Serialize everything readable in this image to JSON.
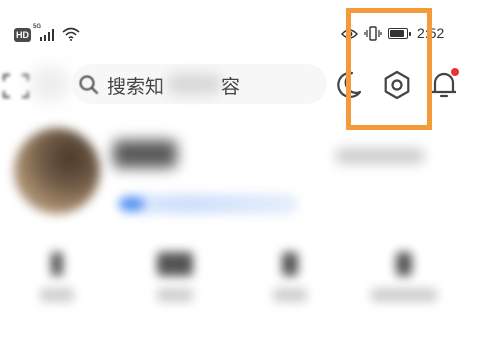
{
  "status_bar": {
    "hd_label": "HD",
    "network_label": "5G",
    "time": "2:52",
    "icons": [
      "signal-icon",
      "wifi-icon",
      "eye-icon",
      "vibrate-icon",
      "battery-icon"
    ]
  },
  "search_bar": {
    "text_start": "搜索知",
    "text_end": "容",
    "icon": "search-icon"
  },
  "toolbar": {
    "icons": [
      "scan-icon",
      "dark-mode-icon",
      "settings-icon",
      "notification-bell-icon"
    ],
    "notification_dot": true
  },
  "highlight": {
    "target": "settings-icon",
    "color": "#F39A3B"
  },
  "colors": {
    "highlight_orange": "#F39A3B",
    "notification_red": "#E8333A",
    "badge_blue": "#4A8CF0",
    "text_dark": "#333333"
  }
}
